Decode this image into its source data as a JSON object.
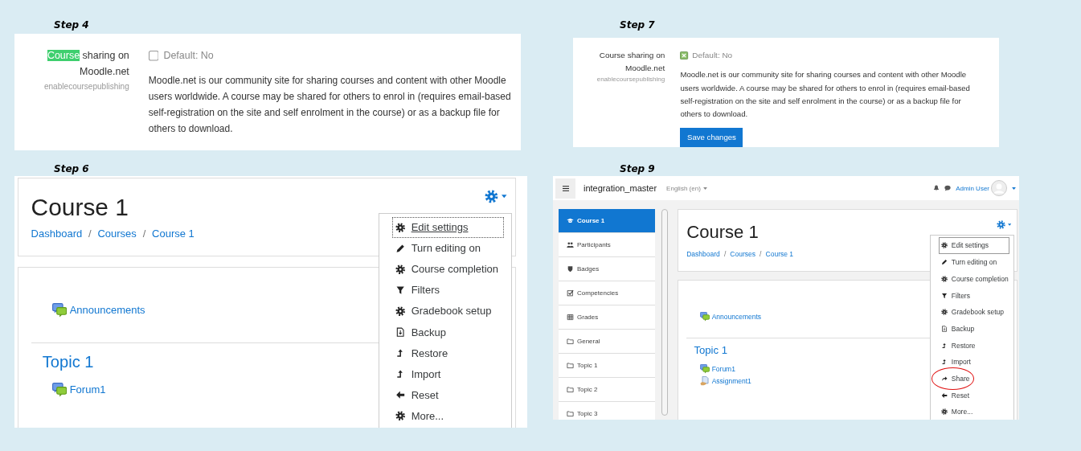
{
  "steps": [
    {
      "kind": "setting",
      "label": "Step 4",
      "setting": {
        "title_parts": [
          {
            "text": "Course",
            "highlighted": true
          },
          {
            "text": "sharing on Moodle.net",
            "highlighted": false
          }
        ],
        "key": "enablecoursepublishing",
        "checked": false,
        "default": "Default: No",
        "description": "Moodle.net is our community site for sharing courses and content with other Moodle users worldwide. A course may be shared for others to enrol in (requires email-based self-registration on the site and self enrolment in the course) or as a backup file for others to download."
      }
    },
    {
      "kind": "setting",
      "label": "Step 7",
      "setting": {
        "title_parts": [
          {
            "text": "Course sharing on Moodle.net",
            "highlighted": false
          }
        ],
        "key": "enablecoursepublishing",
        "checked": true,
        "default": "Default: No",
        "description": "Moodle.net is our community site for sharing courses and content with other Moodle users worldwide. A course may be shared for others to enrol in (requires email-based self-registration on the site and self enrolment in the course) or as a backup file for others to download.",
        "button": "Save changes"
      }
    },
    {
      "kind": "course",
      "label": "Step 6",
      "course": {
        "title": "Course 1",
        "breadcrumbs": [
          "Dashboard",
          "Courses",
          "Course 1"
        ],
        "separator": "/",
        "menu": [
          {
            "label": "Edit settings",
            "kind": "settings",
            "selected": true,
            "circled": false
          },
          {
            "label": "Turn editing on",
            "kind": "edit",
            "selected": false,
            "circled": false
          },
          {
            "label": "Course completion",
            "kind": "settings",
            "selected": false,
            "circled": false
          },
          {
            "label": "Filters",
            "kind": "filter",
            "selected": false,
            "circled": false
          },
          {
            "label": "Gradebook setup",
            "kind": "settings",
            "selected": false,
            "circled": false
          },
          {
            "label": "Backup",
            "kind": "backup",
            "selected": false,
            "circled": false
          },
          {
            "label": "Restore",
            "kind": "restore",
            "selected": false,
            "circled": false
          },
          {
            "label": "Import",
            "kind": "restore",
            "selected": false,
            "circled": false
          },
          {
            "label": "Reset",
            "kind": "reset",
            "selected": false,
            "circled": false
          },
          {
            "label": "More...",
            "kind": "settings",
            "selected": false,
            "circled": false
          }
        ],
        "announcements": {
          "label": "Announcements",
          "kind": "forum"
        },
        "section": "Topic 1",
        "activities": [
          {
            "label": "Forum1",
            "kind": "forum"
          }
        ]
      }
    },
    {
      "kind": "course_page",
      "label": "Step 9",
      "navbar": {
        "site": "integration_master",
        "language": "English (en)",
        "user": "Admin User"
      },
      "sidebar": [
        {
          "label": "Course 1",
          "kind": "course",
          "selected": true
        },
        {
          "label": "Participants",
          "kind": "participants",
          "selected": false
        },
        {
          "label": "Badges",
          "kind": "badges",
          "selected": false
        },
        {
          "label": "Competencies",
          "kind": "competencies",
          "selected": false
        },
        {
          "label": "Grades",
          "kind": "grades",
          "selected": false
        },
        {
          "label": "General",
          "kind": "folder",
          "selected": false
        },
        {
          "label": "Topic 1",
          "kind": "folder",
          "selected": false
        },
        {
          "label": "Topic 2",
          "kind": "folder",
          "selected": false
        },
        {
          "label": "Topic 3",
          "kind": "folder",
          "selected": false
        }
      ],
      "course": {
        "title": "Course 1",
        "breadcrumbs": [
          "Dashboard",
          "Courses",
          "Course 1"
        ],
        "separator": "/",
        "menu": [
          {
            "label": "Edit settings",
            "kind": "settings",
            "selected": true,
            "circled": false
          },
          {
            "label": "Turn editing on",
            "kind": "edit",
            "selected": false,
            "circled": false
          },
          {
            "label": "Course completion",
            "kind": "settings",
            "selected": false,
            "circled": false
          },
          {
            "label": "Filters",
            "kind": "filter",
            "selected": false,
            "circled": false
          },
          {
            "label": "Gradebook setup",
            "kind": "settings",
            "selected": false,
            "circled": false
          },
          {
            "label": "Backup",
            "kind": "backup",
            "selected": false,
            "circled": false
          },
          {
            "label": "Restore",
            "kind": "restore",
            "selected": false,
            "circled": false
          },
          {
            "label": "Import",
            "kind": "restore",
            "selected": false,
            "circled": false
          },
          {
            "label": "Share",
            "kind": "share",
            "selected": false,
            "circled": true
          },
          {
            "label": "Reset",
            "kind": "reset",
            "selected": false,
            "circled": false
          },
          {
            "label": "More...",
            "kind": "settings",
            "selected": false,
            "circled": false
          }
        ],
        "announcements": {
          "label": "Announcements",
          "kind": "forum"
        },
        "section": "Topic 1",
        "activities": [
          {
            "label": "Forum1",
            "kind": "forum"
          },
          {
            "label": "Assignment1",
            "kind": "assignment"
          }
        ]
      }
    }
  ]
}
